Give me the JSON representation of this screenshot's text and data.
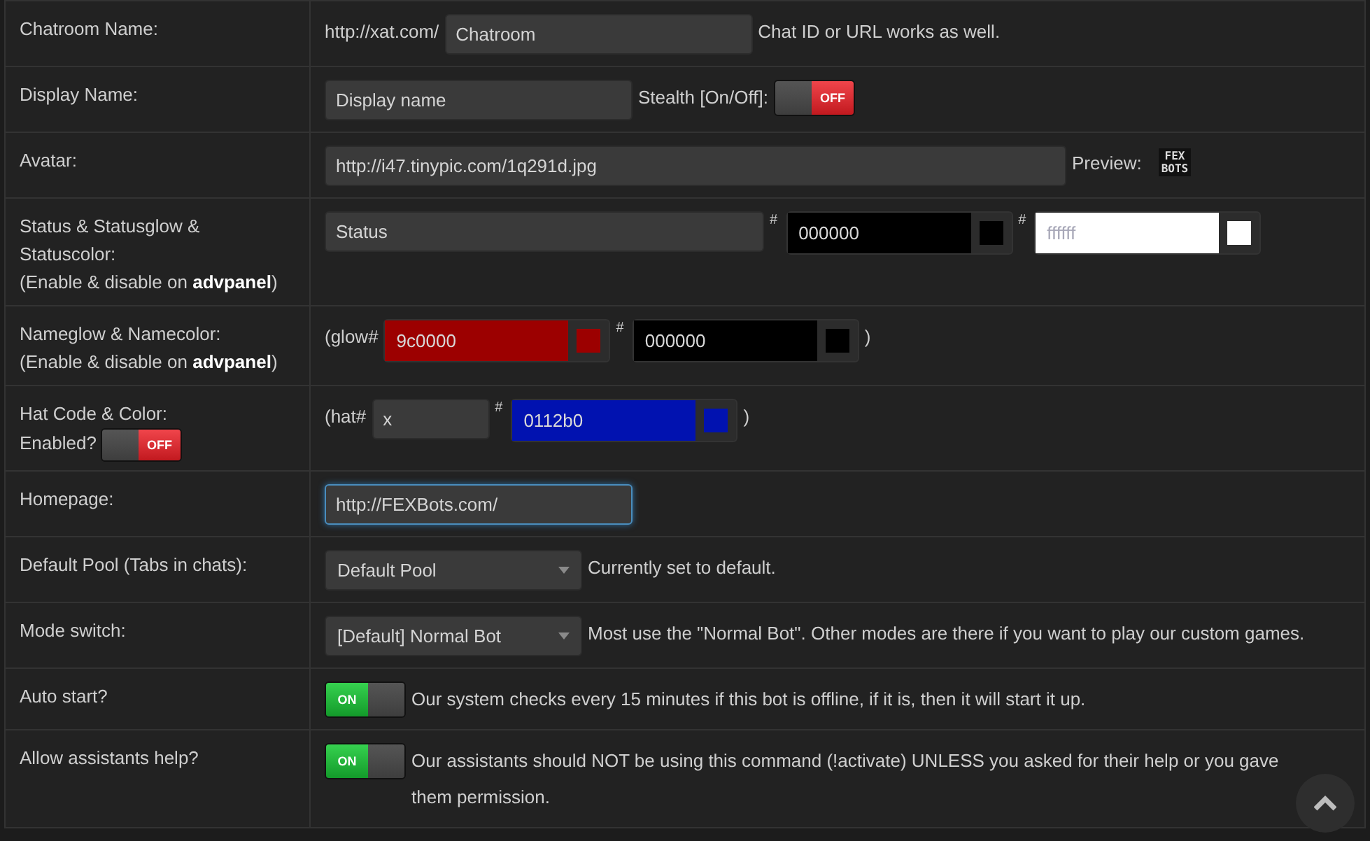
{
  "rows": [
    {
      "label": [
        {
          "kind": "text",
          "text": "Chatroom Name:"
        }
      ],
      "content": [
        {
          "kind": "text",
          "text": "http://xat.com/"
        },
        {
          "kind": "field",
          "value": "Chatroom",
          "focused": false
        },
        {
          "kind": "text",
          "text": "Chat ID or URL works as well."
        }
      ]
    },
    {
      "label": [
        {
          "kind": "text",
          "text": "Display Name:"
        }
      ],
      "content": [
        {
          "kind": "field",
          "value": "Display name",
          "focused": false
        },
        {
          "kind": "text",
          "text": "Stealth [On/Off]:"
        },
        {
          "kind": "toggle",
          "on": false,
          "label": "OFF"
        }
      ]
    },
    {
      "label": [
        {
          "kind": "text",
          "text": "Avatar:"
        }
      ],
      "content": [
        {
          "kind": "longfield",
          "value": "http://i47.tinypic.com/1q291d.jpg",
          "focused": false
        },
        {
          "kind": "text",
          "text": "Preview:"
        },
        {
          "kind": "logo",
          "lines": [
            "FEX",
            "BOTS"
          ]
        }
      ]
    },
    {
      "label": [
        {
          "kind": "text",
          "text": "Status & Statusglow & Statuscolor:"
        },
        {
          "kind": "text",
          "text": "(Enable & disable on **advpanel**)"
        }
      ],
      "content": [
        {
          "kind": "widefield",
          "value": "Status",
          "focused": false
        },
        {
          "kind": "hash",
          "text": "#"
        },
        {
          "kind": "color",
          "value": "000000",
          "color": "#000000"
        },
        {
          "kind": "hash",
          "text": "#"
        },
        {
          "kind": "color",
          "value": "ffffff",
          "color": "#ffffff"
        }
      ]
    },
    {
      "label": [
        {
          "kind": "text",
          "text": "Nameglow & Namecolor:"
        },
        {
          "kind": "text",
          "text": "(Enable & disable on **advpanel**)"
        }
      ],
      "content": [
        {
          "kind": "text",
          "text": "(glow#"
        },
        {
          "kind": "color",
          "value": "9c0000",
          "color": "#9c0000"
        },
        {
          "kind": "hash",
          "text": "#"
        },
        {
          "kind": "color",
          "value": "000000",
          "color": "#000000"
        },
        {
          "kind": "text",
          "text": ")"
        }
      ]
    },
    {
      "label": [
        {
          "kind": "text",
          "text": "Hat Code & Color:"
        },
        {
          "kind": "text",
          "text": "Enabled?"
        },
        {
          "kind": "toggle",
          "on": false,
          "label": "OFF"
        }
      ],
      "content": [
        {
          "kind": "text",
          "text": "(hat#"
        },
        {
          "kind": "shortfield",
          "value": "x",
          "focused": false
        },
        {
          "kind": "hash",
          "text": "#"
        },
        {
          "kind": "color",
          "value": "0112b0",
          "color": "#0112b0"
        },
        {
          "kind": "text",
          "text": ")"
        }
      ]
    },
    {
      "label": [
        {
          "kind": "text",
          "text": "Homepage:"
        }
      ],
      "content": [
        {
          "kind": "field",
          "value": "http://FEXBots.com/",
          "focused": true
        }
      ]
    },
    {
      "label": [
        {
          "kind": "text",
          "text": "Default Pool (Tabs in chats):"
        }
      ],
      "content": [
        {
          "kind": "select",
          "value": "Default Pool"
        },
        {
          "kind": "text",
          "text": "Currently set to default."
        }
      ]
    },
    {
      "label": [
        {
          "kind": "text",
          "text": "Mode switch:"
        }
      ],
      "content": [
        {
          "kind": "select",
          "value": "[Default] Normal Bot"
        },
        {
          "kind": "text",
          "text": "Most use the \"Normal Bot\". Other modes are there if you want to play our custom games."
        }
      ]
    },
    {
      "label": [
        {
          "kind": "text",
          "text": "Auto start?"
        }
      ],
      "content": [
        {
          "kind": "toggle",
          "on": true,
          "label": "ON"
        },
        {
          "kind": "text",
          "text": "Our system checks every 15 minutes if this bot is offline, if it is, then it will start it up."
        }
      ]
    },
    {
      "label": [
        {
          "kind": "text",
          "text": "Allow assistants help?"
        }
      ],
      "content": [
        {
          "kind": "toggle",
          "on": true,
          "label": "ON"
        },
        {
          "kind": "text",
          "text": "Our assistants should NOT be using this command (!activate) UNLESS you asked for their help or you gave them permission."
        }
      ]
    }
  ]
}
